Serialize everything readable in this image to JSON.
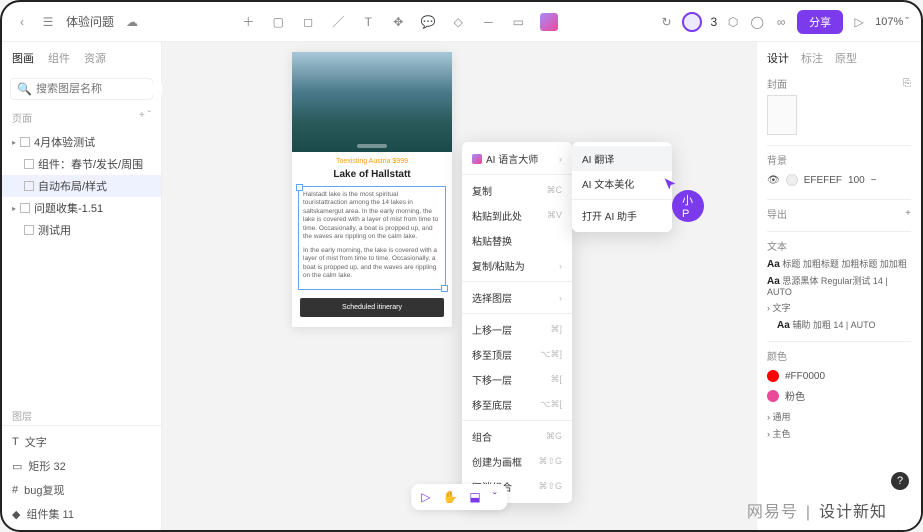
{
  "topbar": {
    "title": "体验问题",
    "share_label": "分享",
    "zoom": "107%",
    "count": "3"
  },
  "left": {
    "tabs": [
      "图画",
      "组件",
      "资源"
    ],
    "search_placeholder": "搜索图层名称",
    "section1": "页面",
    "tree": [
      {
        "label": "4月体验测试",
        "t": "folder"
      },
      {
        "label": "组件：春节/发长/周围",
        "t": "page",
        "sub": true
      },
      {
        "label": "自动布局/样式",
        "t": "page",
        "sub": true,
        "sel": true
      },
      {
        "label": "问题收集-1.51",
        "t": "folder"
      },
      {
        "label": "测试用",
        "t": "page",
        "sub": true
      }
    ],
    "section2": "图层",
    "bottom": [
      {
        "label": "文字",
        "icon": "T",
        "purple": false
      },
      {
        "label": "矩形 32",
        "icon": "▭",
        "purple": true
      },
      {
        "label": "bug复现",
        "icon": "#",
        "purple": false
      },
      {
        "label": "组件集 11",
        "icon": "◆",
        "purple": true
      }
    ]
  },
  "artboard": {
    "caption": "Toexisting Austria $999",
    "title": "Lake of Hallstatt",
    "p1": "Halstadt lake is the most spiritual touristattraction among the 14 lakes in saltskamergut area. In the early morning, the lake is covered with a layer of mist from time to time. Occasionally, a boat is propped up, and the waves are rippling on the calm lake.",
    "p2": "In the early morning, the lake is covered with a layer of mist from time to time. Occasionally, a boat is propped up, and the waves are rippling on the calm lake.",
    "button": "Scheduled itinerary"
  },
  "ctx": {
    "ai_label": "AI 语言大师",
    "items": [
      {
        "label": "复制",
        "sc": "⌘C"
      },
      {
        "label": "粘贴到此处",
        "sc": "⌘V"
      },
      {
        "label": "粘贴替换",
        "sc": ""
      },
      {
        "label": "复制/粘贴为",
        "sc": "›",
        "arrow": true
      }
    ],
    "sel_label": "选择图层",
    "sel_arrow": "›",
    "layer": [
      {
        "label": "上移一层",
        "sc": "⌘]"
      },
      {
        "label": "移至顶层",
        "sc": "⌥⌘]"
      },
      {
        "label": "下移一层",
        "sc": "⌘["
      },
      {
        "label": "移至底层",
        "sc": "⌥⌘["
      }
    ],
    "group": [
      {
        "label": "组合",
        "sc": "⌘G"
      },
      {
        "label": "创建为画框",
        "sc": "⌘⇧G"
      },
      {
        "label": "取消组合",
        "sc": "⌘⇧G"
      }
    ]
  },
  "submenu": {
    "items": [
      {
        "label": "AI 翻译",
        "hl": true
      },
      {
        "label": "AI 文本美化"
      },
      {
        "label": "打开 AI 助手"
      }
    ]
  },
  "bubble": "小P",
  "right": {
    "tabs": [
      "设计",
      "标注",
      "原型"
    ],
    "cover": "封面",
    "bg_label": "背景",
    "bg_color": "EFEFEF",
    "bg_opacity": "100",
    "export": "导出",
    "text_label": "文本",
    "typo1_prefix": "Aa",
    "typo1": "标题 加粗标题 加粗标题 加加粗",
    "typo2_prefix": "Aa",
    "typo2": "思源黑体 Regular测试 14 | AUTO",
    "typo3_label": "› 文字",
    "typo3_prefix": "Aa",
    "typo3": "辅助 加粗 14 | AUTO",
    "color_label": "颜色",
    "colors": [
      {
        "name": "#FF0000",
        "hex": "#ff0000"
      },
      {
        "name": "粉色",
        "hex": "#ec4899"
      }
    ],
    "general": "› 通用",
    "primary": "› 主色"
  },
  "watermark": {
    "a": "网易号",
    "sep": "|",
    "b": "设计新知"
  }
}
